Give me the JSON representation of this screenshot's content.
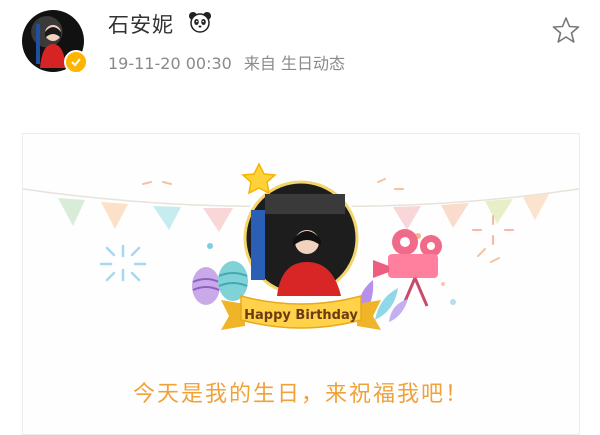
{
  "post": {
    "author": "石安妮",
    "timestamp": "19-11-20 00:30",
    "source_prefix": "来自",
    "source": "生日动态",
    "badge_icon": "panda-icon",
    "verified_icon": "verified-check-icon",
    "favorite_icon": "star-outline-icon"
  },
  "card": {
    "banner_text": "Happy Birthday",
    "caption": "今天是我的生日，来祝福我吧！"
  },
  "colors": {
    "accent_orange": "#f0a23a",
    "verified_yellow": "#ffb400",
    "meta_gray": "#8a8a8a"
  }
}
